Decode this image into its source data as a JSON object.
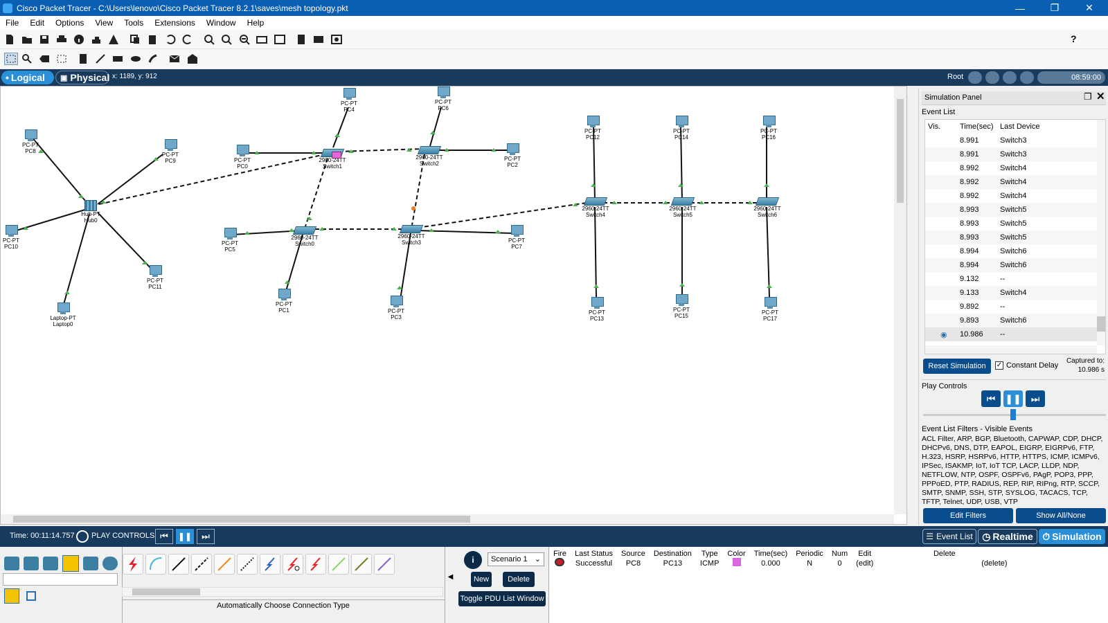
{
  "window": {
    "title": "Cisco Packet Tracer - C:\\Users\\lenovo\\Cisco Packet Tracer 8.2.1\\saves\\mesh topology.pkt"
  },
  "menu": [
    "File",
    "Edit",
    "Options",
    "View",
    "Tools",
    "Extensions",
    "Window",
    "Help"
  ],
  "help_glyph": "?",
  "modebar": {
    "logical": "Logical",
    "physical": "Physical",
    "coords": "x: 1189, y: 912",
    "root": "Root",
    "clock": "08:59:00"
  },
  "devices": {
    "pc8": {
      "type": "PC-PT",
      "name": "PC8"
    },
    "pc9": {
      "type": "PC-PT",
      "name": "PC9"
    },
    "pc10": {
      "type": "PC-PT",
      "name": "PC10"
    },
    "pc11": {
      "type": "PC-PT",
      "name": "PC11"
    },
    "laptop0": {
      "type": "Laptop-PT",
      "name": "Laptop0"
    },
    "hub0": {
      "type": "Hub-PT",
      "name": "Hub0"
    },
    "pc0": {
      "type": "PC-PT",
      "name": "PC0"
    },
    "pc4": {
      "type": "PC-PT",
      "name": "PC4"
    },
    "pc6": {
      "type": "PC-PT",
      "name": "PC6"
    },
    "switch1": {
      "type": "2960-24TT",
      "name": "Switch1"
    },
    "switch2": {
      "type": "2960-24TT",
      "name": "Switch2"
    },
    "pc2": {
      "type": "PC-PT",
      "name": "PC2"
    },
    "pc5": {
      "type": "PC-PT",
      "name": "PC5"
    },
    "switch0": {
      "type": "2960-24TT",
      "name": "Switch0"
    },
    "switch3": {
      "type": "2960-24TT",
      "name": "Switch3"
    },
    "pc7": {
      "type": "PC-PT",
      "name": "PC7"
    },
    "pc1": {
      "type": "PC-PT",
      "name": "PC1"
    },
    "pc3": {
      "type": "PC-PT",
      "name": "PC3"
    },
    "pc12": {
      "type": "PC-PT",
      "name": "PC12"
    },
    "pc14": {
      "type": "PC-PT",
      "name": "PC14"
    },
    "pc16": {
      "type": "PC-PT",
      "name": "PC16"
    },
    "switch4": {
      "type": "2960-24TT",
      "name": "Switch4"
    },
    "switch5": {
      "type": "2960-24TT",
      "name": "Switch5"
    },
    "switch6": {
      "type": "2960-24TT",
      "name": "Switch6"
    },
    "pc13": {
      "type": "PC-PT",
      "name": "PC13"
    },
    "pc15": {
      "type": "PC-PT",
      "name": "PC15"
    },
    "pc17": {
      "type": "PC-PT",
      "name": "PC17"
    }
  },
  "sim": {
    "title": "Simulation Panel",
    "event_list": "Event List",
    "headers": {
      "vis": "Vis.",
      "time": "Time(sec)",
      "last": "Last Device"
    },
    "events": [
      {
        "time": "8.991",
        "dev": "Switch3"
      },
      {
        "time": "8.991",
        "dev": "Switch3"
      },
      {
        "time": "8.992",
        "dev": "Switch4"
      },
      {
        "time": "8.992",
        "dev": "Switch4"
      },
      {
        "time": "8.992",
        "dev": "Switch4"
      },
      {
        "time": "8.993",
        "dev": "Switch5"
      },
      {
        "time": "8.993",
        "dev": "Switch5"
      },
      {
        "time": "8.993",
        "dev": "Switch5"
      },
      {
        "time": "8.994",
        "dev": "Switch6"
      },
      {
        "time": "8.994",
        "dev": "Switch6"
      },
      {
        "time": "9.132",
        "dev": "--"
      },
      {
        "time": "9.133",
        "dev": "Switch4"
      },
      {
        "time": "9.892",
        "dev": "--"
      },
      {
        "time": "9.893",
        "dev": "Switch6"
      },
      {
        "time": "10.986",
        "dev": "--"
      }
    ],
    "reset": "Reset Simulation",
    "constant_delay": "Constant Delay",
    "captured_label": "Captured to:",
    "captured_value": "10.986 s",
    "play_controls": "Play Controls",
    "filters_title": "Event List Filters - Visible Events",
    "filters_text": "ACL Filter, ARP, BGP, Bluetooth, CAPWAP, CDP, DHCP, DHCPv6, DNS, DTP, EAPOL, EIGRP, EIGRPv6, FTP, H.323, HSRP, HSRPv6, HTTP, HTTPS, ICMP, ICMPv6, IPSec, ISAKMP, IoT, IoT TCP, LACP, LLDP, NDP, NETFLOW, NTP, OSPF, OSPFv6, PAgP, POP3, PPP, PPPoED, PTP, RADIUS, REP, RIP, RIPng, RTP, SCCP, SMTP, SNMP, SSH, STP, SYSLOG, TACACS, TCP, TFTP, Telnet, UDP, USB, VTP",
    "edit_filters": "Edit Filters",
    "show_all": "Show All/None"
  },
  "bottombar": {
    "time": "Time: 00:11:14.757",
    "play": "PLAY CONTROLS",
    "event_list": "Event List",
    "realtime": "Realtime",
    "simulation": "Simulation"
  },
  "bottom": {
    "conn_hint": "Automatically Choose Connection Type",
    "scenario": "Scenario 1",
    "new": "New",
    "delete": "Delete",
    "toggle": "Toggle PDU List Window",
    "pdu_headers": [
      "Fire",
      "Last Status",
      "Source",
      "Destination",
      "Type",
      "Color",
      "Time(sec)",
      "Periodic",
      "Num",
      "Edit",
      "Delete"
    ],
    "pdu_row": {
      "status": "Successful",
      "source": "PC8",
      "dest": "PC13",
      "type": "ICMP",
      "color": "#d966e0",
      "time": "0.000",
      "periodic": "N",
      "num": "0",
      "edit": "(edit)",
      "delete": "(delete)"
    }
  }
}
